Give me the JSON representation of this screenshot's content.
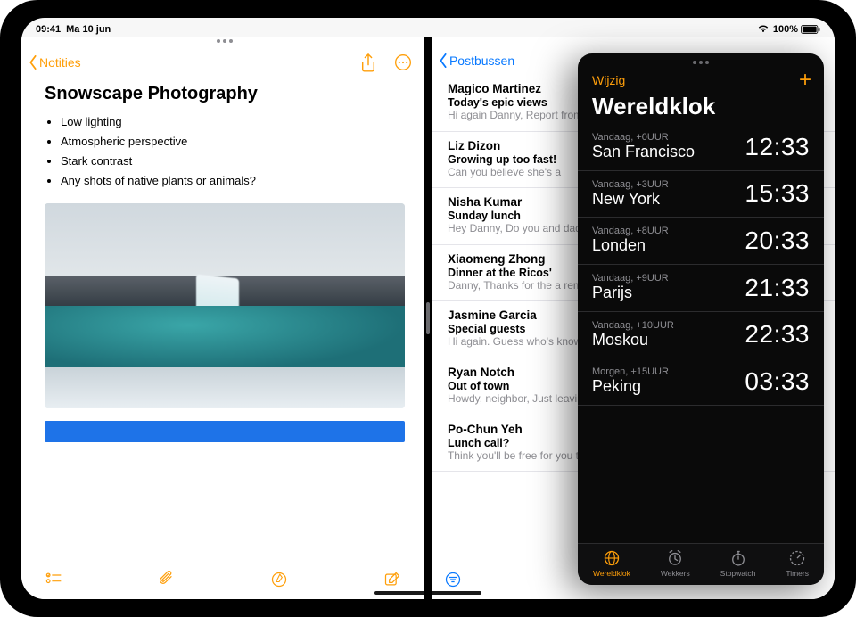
{
  "status": {
    "time": "09:41",
    "date": "Ma 10 jun",
    "battery_pct": "100%"
  },
  "notes": {
    "back_label": "Notities",
    "title": "Snowscape Photography",
    "bullets": [
      "Low lighting",
      "Atmospheric perspective",
      "Stark contrast",
      "Any shots of native plants or animals?"
    ]
  },
  "mail": {
    "back_label": "Postbussen",
    "items": [
      {
        "sender": "Magico Martinez",
        "subject": "Today's epic views",
        "preview": "Hi again Danny, Report from the field. Wide open skies, a ger"
      },
      {
        "sender": "Liz Dizon",
        "subject": "Growing up too fast!",
        "preview": "Can you believe she's a"
      },
      {
        "sender": "Nisha Kumar",
        "subject": "Sunday lunch",
        "preview": "Hey Danny, Do you and dad? If you two join, th"
      },
      {
        "sender": "Xiaomeng Zhong",
        "subject": "Dinner at the Ricos'",
        "preview": "Danny, Thanks for the a remembered to take or"
      },
      {
        "sender": "Jasmine Garcia",
        "subject": "Special guests",
        "preview": "Hi again. Guess who's know how to make me"
      },
      {
        "sender": "Ryan Notch",
        "subject": "Out of town",
        "preview": "Howdy, neighbor, Just leaving Tuesday and c"
      },
      {
        "sender": "Po-Chun Yeh",
        "subject": "Lunch call?",
        "preview": "Think you'll be free for you think might work a"
      }
    ]
  },
  "clock": {
    "edit_label": "Wijzig",
    "title": "Wereldklok",
    "rows": [
      {
        "meta": "Vandaag, +0UUR",
        "city": "San Francisco",
        "time": "12:33"
      },
      {
        "meta": "Vandaag, +3UUR",
        "city": "New York",
        "time": "15:33"
      },
      {
        "meta": "Vandaag, +8UUR",
        "city": "Londen",
        "time": "20:33"
      },
      {
        "meta": "Vandaag, +9UUR",
        "city": "Parijs",
        "time": "21:33"
      },
      {
        "meta": "Vandaag, +10UUR",
        "city": "Moskou",
        "time": "22:33"
      },
      {
        "meta": "Morgen, +15UUR",
        "city": "Peking",
        "time": "03:33"
      }
    ],
    "tabs": [
      {
        "label": "Wereldklok",
        "icon": "globe-icon",
        "active": true
      },
      {
        "label": "Wekkers",
        "icon": "alarm-icon",
        "active": false
      },
      {
        "label": "Stopwatch",
        "icon": "stopwatch-icon",
        "active": false
      },
      {
        "label": "Timers",
        "icon": "timer-icon",
        "active": false
      }
    ]
  }
}
